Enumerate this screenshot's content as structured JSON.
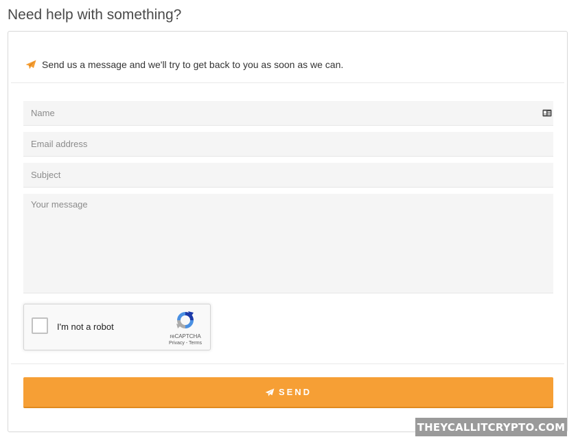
{
  "page": {
    "title": "Need help with something?"
  },
  "form": {
    "intro": "Send us a message and we'll try to get back to you as soon as we can.",
    "name_placeholder": "Name",
    "name_value": "",
    "email_placeholder": "Email address",
    "email_value": "",
    "subject_placeholder": "Subject",
    "subject_value": "",
    "message_placeholder": "Your message",
    "message_value": "",
    "send_label": "SEND"
  },
  "recaptcha": {
    "label": "I'm not a robot",
    "brand": "reCAPTCHA",
    "privacy": "Privacy",
    "separator": " - ",
    "terms": "Terms",
    "checked": false
  },
  "watermark": {
    "text": "THEYCALLITCRYPTO.COM"
  },
  "icons": {
    "intro": "paper-plane-icon",
    "name_field": "id-card-icon",
    "send": "paper-plane-icon",
    "recaptcha": "recaptcha-logo-icon"
  },
  "colors": {
    "accent": "#f69f35",
    "field_bg": "#f5f5f5",
    "title_text": "#4a4a4a"
  }
}
